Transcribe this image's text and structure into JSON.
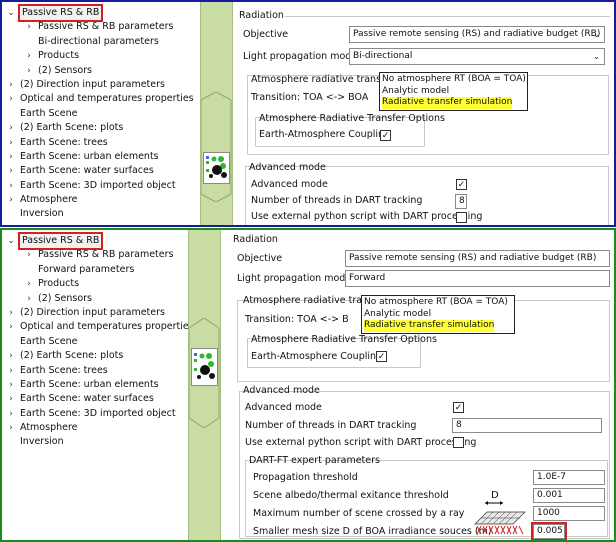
{
  "screenshot1": {
    "tree": [
      {
        "label": "Passive RS & RB",
        "arrow": "⌄",
        "level": 0,
        "selected": true
      },
      {
        "label": "Passive RS & RB parameters",
        "arrow": "›",
        "level": 1
      },
      {
        "label": "Bi-directional parameters",
        "arrow": "",
        "level": 1
      },
      {
        "label": "Products",
        "arrow": "›",
        "level": 1
      },
      {
        "label": "(2) Sensors",
        "arrow": "›",
        "level": 1
      },
      {
        "label": "(2) Direction input parameters",
        "arrow": "›",
        "level": 0
      },
      {
        "label": "Optical and temperatures properties",
        "arrow": "›",
        "level": 0
      },
      {
        "label": "Earth Scene",
        "arrow": "",
        "level": 0
      },
      {
        "label": "(2) Earth Scene: plots",
        "arrow": "›",
        "level": 0
      },
      {
        "label": "Earth Scene: trees",
        "arrow": "›",
        "level": 0
      },
      {
        "label": "Earth Scene: urban elements",
        "arrow": "›",
        "level": 0
      },
      {
        "label": "Earth Scene: water surfaces",
        "arrow": "›",
        "level": 0
      },
      {
        "label": "Earth Scene: 3D imported object",
        "arrow": "›",
        "level": 0
      },
      {
        "label": "Atmosphere",
        "arrow": "›",
        "level": 0
      },
      {
        "label": "Inversion",
        "arrow": "",
        "level": 0
      }
    ],
    "panel": {
      "section_title": "Radiation",
      "objective_label": "Objective",
      "objective_value": "Passive remote sensing (RS) and radiative budget (RB)",
      "light_label": "Light propagation mode",
      "light_value": "Bi-directional",
      "atm_title": "Atmosphere radiative transfer",
      "transition_label": "Transition: TOA <-> BOA",
      "popup": [
        "No atmosphere RT (BOA = TOA)",
        "Analytic model",
        "Radiative transfer simulation"
      ],
      "rt_options_title": "Atmosphere Radiative Transfer Options",
      "coupling_label": "Earth-Atmosphere Coupling",
      "coupling_checked": "✓",
      "adv_title": "Advanced mode",
      "adv_mode_label": "Advanced mode",
      "adv_mode_checked": "✓",
      "threads_label": "Number of threads in DART tracking",
      "threads_value": "8",
      "python_label": "Use external python script with DART processing",
      "python_checked": ""
    }
  },
  "screenshot2": {
    "tree": [
      {
        "label": "Passive RS & RB",
        "arrow": "⌄",
        "level": 0,
        "selected": true
      },
      {
        "label": "Passive RS & RB parameters",
        "arrow": "›",
        "level": 1
      },
      {
        "label": "Forward parameters",
        "arrow": "",
        "level": 1
      },
      {
        "label": "Products",
        "arrow": "›",
        "level": 1
      },
      {
        "label": "(2) Sensors",
        "arrow": "›",
        "level": 1
      },
      {
        "label": "(2) Direction input parameters",
        "arrow": "›",
        "level": 0
      },
      {
        "label": "Optical and temperatures properties",
        "arrow": "›",
        "level": 0
      },
      {
        "label": "Earth Scene",
        "arrow": "",
        "level": 0
      },
      {
        "label": "(2) Earth Scene: plots",
        "arrow": "›",
        "level": 0
      },
      {
        "label": "Earth Scene: trees",
        "arrow": "›",
        "level": 0
      },
      {
        "label": "Earth Scene: urban elements",
        "arrow": "›",
        "level": 0
      },
      {
        "label": "Earth Scene: water surfaces",
        "arrow": "›",
        "level": 0
      },
      {
        "label": "Earth Scene: 3D imported object",
        "arrow": "›",
        "level": 0
      },
      {
        "label": "Atmosphere",
        "arrow": "›",
        "level": 0
      },
      {
        "label": "Inversion",
        "arrow": "",
        "level": 0
      }
    ],
    "panel": {
      "section_title": "Radiation",
      "objective_label": "Objective",
      "objective_value": "Passive remote sensing (RS) and radiative budget (RB)",
      "light_label": "Light propagation mode",
      "light_value": "Forward",
      "atm_title": "Atmosphere radiative transf",
      "transition_label": "Transition: TOA <-> B",
      "popup": [
        "No atmosphere RT (BOA = TOA)",
        "Analytic model",
        "Radiative transfer simulation"
      ],
      "rt_options_title": "Atmosphere Radiative Transfer Options",
      "coupling_label": "Earth-Atmosphere Coupling",
      "coupling_checked": "✓",
      "adv_title": "Advanced mode",
      "adv_mode_label": "Advanced mode",
      "adv_mode_checked": "✓",
      "threads_label": "Number of threads in DART tracking",
      "threads_value": "8",
      "python_label": "Use external python script with DART processing",
      "python_checked": "",
      "ft_title": "DART-FT expert parameters",
      "ft_params": [
        {
          "label": "Propagation threshold",
          "value": "1.0E-7"
        },
        {
          "label": "Scene albedo/thermal exitance threshold",
          "value": "0.001"
        },
        {
          "label": "Maximum number of scene crossed by a ray",
          "value": "1000"
        },
        {
          "label": "Smaller mesh size D of BOA irradiance souces (m)",
          "value": "0.005"
        }
      ],
      "mesh_d_label": "D"
    }
  },
  "colors": {
    "frame1_border": "#1a1a9c",
    "frame2_border": "#1d8a1d",
    "selection_outline": "#d42020",
    "splitter": "#c8dca4",
    "popup_highlight": "#ffff33"
  }
}
